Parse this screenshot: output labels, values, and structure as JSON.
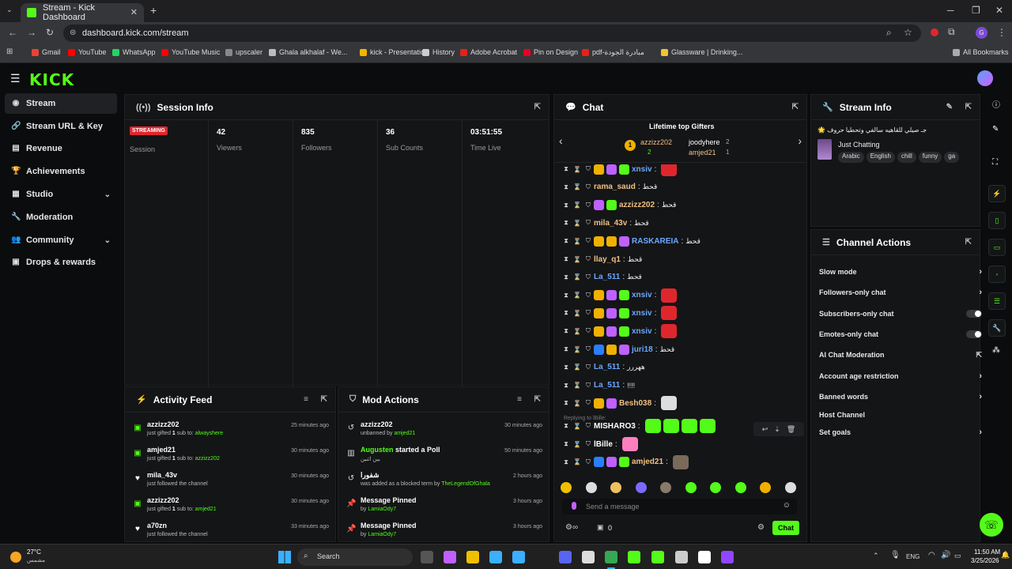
{
  "browser": {
    "tab_title": "Stream - Kick Dashboard",
    "new_tab": "+",
    "url": "dashboard.kick.com/stream",
    "bookmarks": [
      {
        "label": "Gmail",
        "color": "#ea4335"
      },
      {
        "label": "YouTube",
        "color": "#ff0000"
      },
      {
        "label": "WhatsApp",
        "color": "#25d366"
      },
      {
        "label": "YouTube Music",
        "color": "#ff0000"
      },
      {
        "label": "upscaler",
        "color": "#888888"
      },
      {
        "label": "Ghala alkhalaf - We...",
        "color": "#bbbbbb"
      },
      {
        "label": "kick - Presentation",
        "color": "#f4b400"
      },
      {
        "label": "History",
        "color": "#cccccc"
      },
      {
        "label": "Adobe Acrobat",
        "color": "#e2231a"
      },
      {
        "label": "Pin on Design",
        "color": "#e60023"
      },
      {
        "label": "pdf-مبادرة الجودة",
        "color": "#e2231a"
      },
      {
        "label": "Glassware | Drinking...",
        "color": "#f1c232"
      }
    ],
    "all_bookmarks": "All Bookmarks"
  },
  "app": {
    "logo": "KICK"
  },
  "sidebar": {
    "items": [
      {
        "label": "Stream",
        "icon": "broadcast-icon"
      },
      {
        "label": "Stream URL & Key",
        "icon": "link-icon"
      },
      {
        "label": "Revenue",
        "icon": "revenue-icon"
      },
      {
        "label": "Achievements",
        "icon": "trophy-icon"
      },
      {
        "label": "Studio",
        "icon": "studio-icon"
      },
      {
        "label": "Moderation",
        "icon": "wrench-icon"
      },
      {
        "label": "Community",
        "icon": "community-icon"
      },
      {
        "label": "Drops & rewards",
        "icon": "gift-icon"
      }
    ]
  },
  "session": {
    "title": "Session Info",
    "badge": "STREAMING",
    "session_label": "Session",
    "stats": [
      {
        "value": "42",
        "label": "Viewers"
      },
      {
        "value": "835",
        "label": "Followers"
      },
      {
        "value": "36",
        "label": "Sub Counts"
      },
      {
        "value": "03:51:55",
        "label": "Time Live"
      }
    ]
  },
  "activity": {
    "title": "Activity Feed",
    "items": [
      {
        "name": "azzizz202",
        "pre": "just gifted ",
        "num": "1",
        "mid": " sub to: ",
        "target": "alwayshere",
        "time": "25 minutes ago",
        "icon": "gift-icon"
      },
      {
        "name": "amjed21",
        "pre": "just gifted ",
        "num": "1",
        "mid": " sub to: ",
        "target": "azzizz202",
        "time": "30 minutes ago",
        "icon": "gift-icon"
      },
      {
        "name": "mila_43v",
        "pre": "just followed the channel",
        "num": "",
        "mid": "",
        "target": "",
        "time": "30 minutes ago",
        "icon": "heart-icon"
      },
      {
        "name": "azzizz202",
        "pre": "just gifted ",
        "num": "1",
        "mid": " sub to: ",
        "target": "amjed21",
        "time": "30 minutes ago",
        "icon": "gift-icon"
      },
      {
        "name": "a70zn",
        "pre": "just followed the channel",
        "num": "",
        "mid": "",
        "target": "",
        "time": "33 minutes ago",
        "icon": "heart-icon"
      }
    ]
  },
  "mod": {
    "title": "Mod Actions",
    "items": [
      {
        "name": "azzizz202",
        "name_color": "#ffffff",
        "extra": "",
        "desc": "unbanned by ",
        "by": "amjed21",
        "time": "30 minutes ago",
        "icon": "undo-icon"
      },
      {
        "name": "Augusten",
        "name_color": "#53fc18",
        "extra": " started a Poll",
        "desc": "بين اثنين",
        "by": "",
        "time": "50 minutes ago",
        "icon": "poll-icon"
      },
      {
        "name": "شفورا",
        "name_color": "#ffffff",
        "extra": "",
        "desc": "was added as a blocked term by ",
        "by": "TheLegendOfGhala",
        "time": "2 hours ago",
        "icon": "undo-icon"
      },
      {
        "name": "Message Pinned",
        "name_color": "#ffffff",
        "extra": "",
        "desc": "by ",
        "by": "LamiaOdy7",
        "time": "3 hours ago",
        "icon": "pin-icon"
      },
      {
        "name": "Message Pinned",
        "name_color": "#ffffff",
        "extra": "",
        "desc": "by ",
        "by": "LamiaOdy7",
        "time": "3 hours ago",
        "icon": "pin-icon"
      }
    ]
  },
  "chat": {
    "title": "Chat",
    "gifters_title": "Lifetime top Gifters",
    "gifters": [
      {
        "rank": "1",
        "name": "azzizz202",
        "count": "2"
      },
      {
        "name": "joodyhere",
        "count": "2"
      },
      {
        "name": "amjed21",
        "count": "1"
      }
    ],
    "messages": [
      {
        "user": "xnsiv",
        "color": "#6ba8ff",
        "msg": "",
        "chips": [
          "#f0b000",
          "#c060ff",
          "#53fc18"
        ],
        "emote": "#e0262d"
      },
      {
        "user": "rama_saud",
        "color": "#f0c080",
        "msg": "قحط",
        "chips": [],
        "emote": ""
      },
      {
        "user": "azzizz202",
        "color": "#f0c080",
        "msg": "قحط",
        "chips": [
          "#c060ff",
          "#53fc18"
        ],
        "emote": ""
      },
      {
        "user": "mila_43v",
        "color": "#f0c080",
        "msg": "قحط",
        "chips": [],
        "emote": ""
      },
      {
        "user": "RASKAREIA",
        "color": "#6ba8ff",
        "msg": "قحط",
        "chips": [
          "#f0b000",
          "#f0b000",
          "#c060ff"
        ],
        "emote": ""
      },
      {
        "user": "llay_q1",
        "color": "#f0c080",
        "msg": "قحط",
        "chips": [],
        "emote": ""
      },
      {
        "user": "La_511",
        "color": "#6ba8ff",
        "msg": "قحط",
        "chips": [],
        "emote": ""
      },
      {
        "user": "xnsiv",
        "color": "#6ba8ff",
        "msg": "",
        "chips": [
          "#f0b000",
          "#c060ff",
          "#53fc18"
        ],
        "emote": "#e0262d"
      },
      {
        "user": "xnsiv",
        "color": "#6ba8ff",
        "msg": "",
        "chips": [
          "#f0b000",
          "#c060ff",
          "#53fc18"
        ],
        "emote": "#e0262d"
      },
      {
        "user": "xnsiv",
        "color": "#6ba8ff",
        "msg": "",
        "chips": [
          "#f0b000",
          "#c060ff",
          "#53fc18"
        ],
        "emote": "#e0262d"
      },
      {
        "user": "juri18",
        "color": "#6ba8ff",
        "msg": "قحط",
        "chips": [
          "#2a7fff",
          "#f0b000",
          "#c060ff"
        ],
        "emote": ""
      },
      {
        "user": "La_511",
        "color": "#6ba8ff",
        "msg": "ههررر",
        "chips": [],
        "emote": ""
      },
      {
        "user": "La_511",
        "color": "#6ba8ff",
        "msg": "!!!!",
        "chips": [],
        "emote": ""
      },
      {
        "user": "Besh038",
        "color": "#f0c080",
        "msg": "",
        "chips": [
          "#f0b000",
          "#c060ff"
        ],
        "emote": "#dddddd"
      },
      {
        "user": "MISHARO3",
        "color": "#ffffff",
        "msg": "",
        "chips": [],
        "emote": "#53fc18"
      },
      {
        "user": "lBille",
        "color": "#ffffff",
        "msg": "",
        "chips": [],
        "emote": "#ff7fbf"
      },
      {
        "user": "amjed21",
        "color": "#f0c080",
        "msg": "",
        "chips": [
          "#2a7fff",
          "#c060ff",
          "#53fc18"
        ],
        "emote": "#7a6a5a"
      }
    ],
    "replying_to": "Replying to lBille:",
    "input_placeholder": "Send a message",
    "points": "0",
    "send_label": "Chat"
  },
  "stream_info": {
    "title": "Stream Info",
    "stream_title": "🌟 جـ صيلي للقاهيه سالفي وتحطيا حروف",
    "category": "Just Chatting",
    "tags": [
      "Arabic",
      "English",
      "chill",
      "funny",
      "ga"
    ]
  },
  "channel_actions": {
    "title": "Channel Actions",
    "items": [
      {
        "label": "Slow mode",
        "control": "arrow"
      },
      {
        "label": "Followers-only chat",
        "control": "arrow"
      },
      {
        "label": "Subscribers-only chat",
        "control": "toggle"
      },
      {
        "label": "Emotes-only chat",
        "control": "toggle"
      },
      {
        "label": "AI Chat Moderation",
        "control": "link"
      },
      {
        "label": "Account age restriction",
        "control": "arrow"
      },
      {
        "label": "Banned words",
        "control": "arrow"
      },
      {
        "label": "Host Channel",
        "control": "none"
      },
      {
        "label": "Set goals",
        "control": "arrow"
      }
    ]
  },
  "taskbar": {
    "weather_temp": "27°C",
    "weather_desc": "مشمس",
    "search": "Search",
    "lang": "ENG",
    "time": "11:50 AM",
    "date": "3/25/2026"
  }
}
